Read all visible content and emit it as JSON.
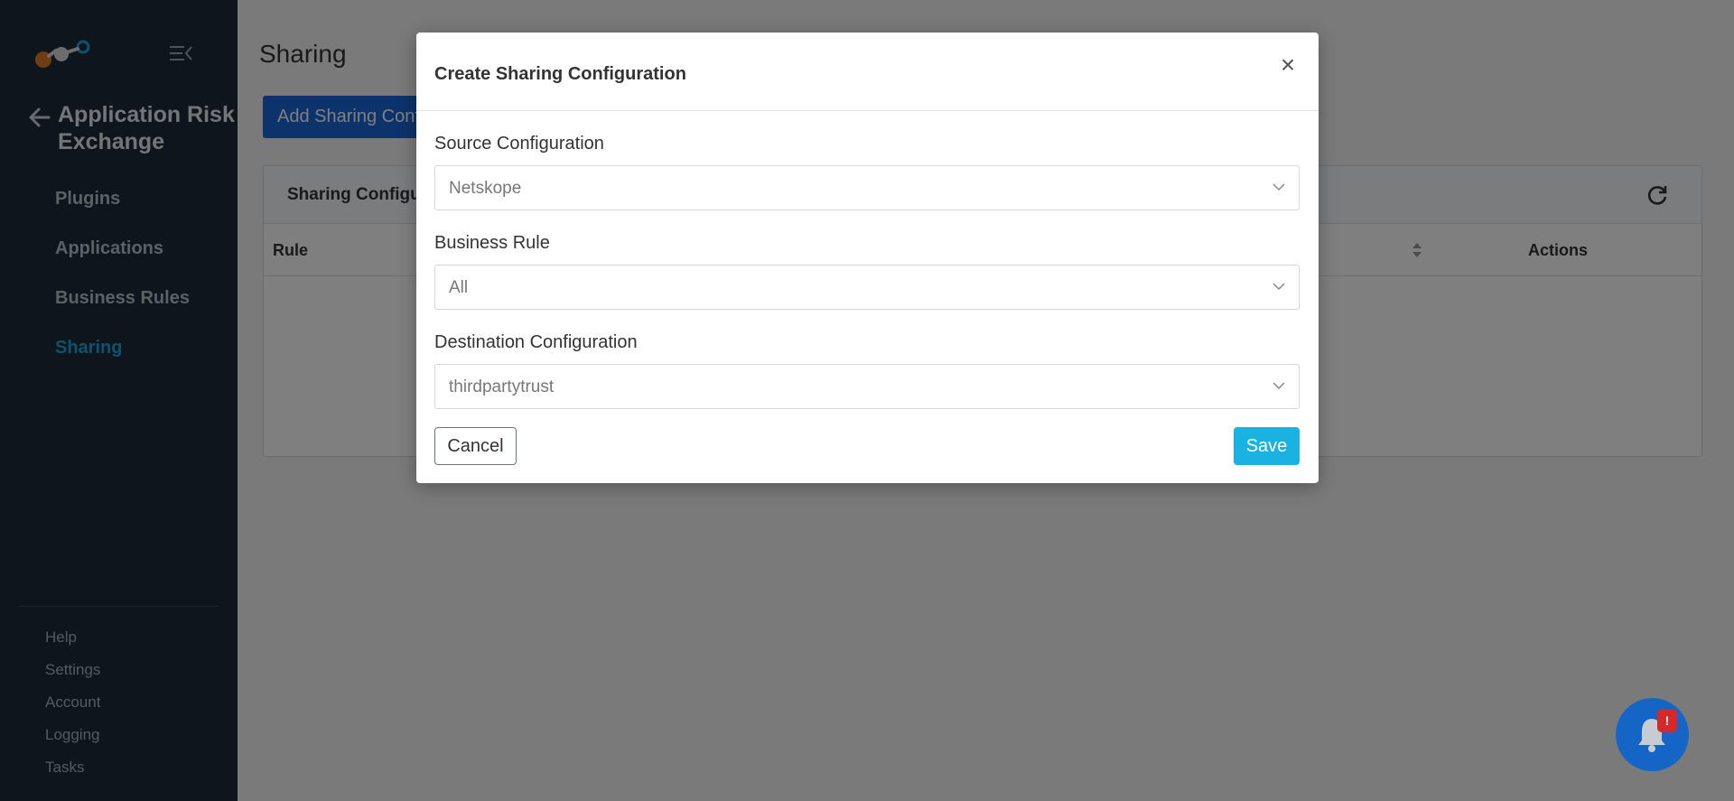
{
  "sidebar": {
    "app_title": "Application Risk Exchange",
    "items": [
      {
        "label": "Plugins"
      },
      {
        "label": "Applications"
      },
      {
        "label": "Business Rules"
      },
      {
        "label": "Sharing"
      }
    ],
    "active_item": "Sharing",
    "bottom_items": [
      {
        "label": "Help"
      },
      {
        "label": "Settings"
      },
      {
        "label": "Account"
      },
      {
        "label": "Logging"
      },
      {
        "label": "Tasks"
      }
    ]
  },
  "main": {
    "page_title": "Sharing",
    "add_button_label": "Add Sharing Configuration",
    "card_title": "Sharing Configurations",
    "table_headers": {
      "rule": "Rule",
      "actions": "Actions"
    }
  },
  "modal": {
    "title": "Create Sharing Configuration",
    "close_symbol": "×",
    "fields": [
      {
        "label": "Source Configuration",
        "value": "Netskope"
      },
      {
        "label": "Business Rule",
        "value": "All"
      },
      {
        "label": "Destination Configuration",
        "value": "thirdpartytrust"
      }
    ],
    "cancel_label": "Cancel",
    "save_label": "Save"
  },
  "notification": {
    "badge": "!"
  },
  "colors": {
    "sidebar_bg": "#1e2a3a",
    "active_nav": "#1aa6d9",
    "primary_button": "#1867d6",
    "save_button": "#1ab2e0",
    "badge": "#d62828"
  },
  "icons": [
    "logo-icon",
    "collapse-menu-icon",
    "back-arrow-icon",
    "refresh-icon",
    "sort-icon",
    "close-icon",
    "chevron-down-icon",
    "bell-icon"
  ]
}
